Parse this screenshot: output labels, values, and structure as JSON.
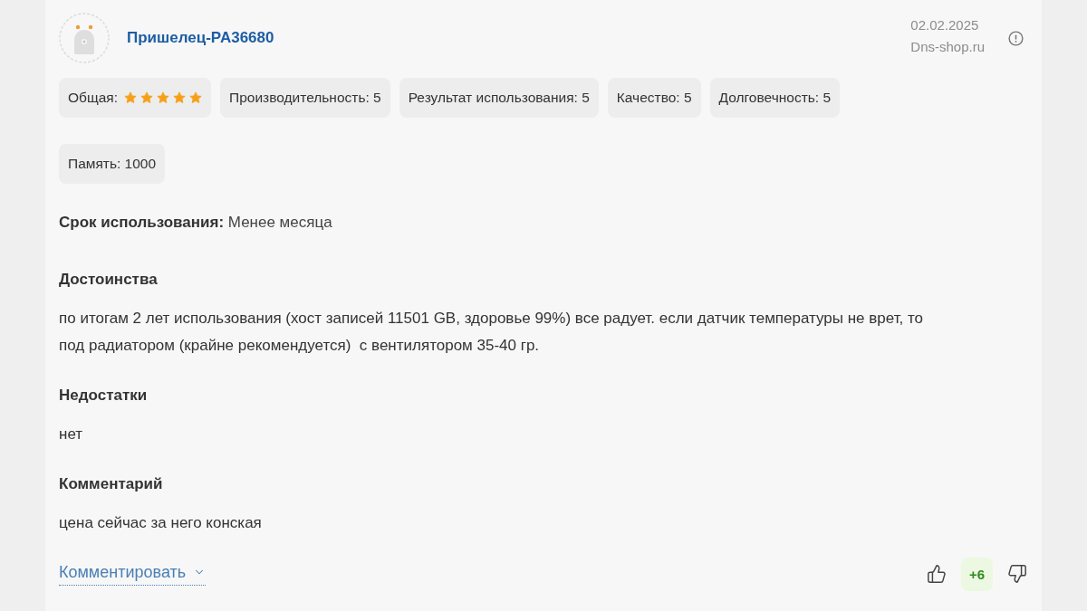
{
  "review": {
    "author": {
      "name": "Пришелец-PA36680"
    },
    "date": "02.02.2025",
    "source": "Dns-shop.ru",
    "ratings": [
      {
        "kind": "stars",
        "label": "Общая:",
        "stars": 5
      },
      {
        "kind": "text",
        "label": "Производительность: 5"
      },
      {
        "kind": "text",
        "label": "Результат использования: 5"
      },
      {
        "kind": "text",
        "label": "Качество: 5"
      },
      {
        "kind": "text",
        "label": "Долговечность: 5"
      }
    ],
    "properties": [
      {
        "label": "Память: 1000"
      }
    ],
    "usage_period": "**Срок использования:** Менее месяца",
    "sections": [
      {
        "heading": "Достоинства",
        "text": "по итогам 2 лет использования (хост записей 11501 GB, здоровье 99%) все радует. если датчик температуры не врет, то под радиатором (крайне рекомендуется)  с вентилятором 35-40 гр."
      },
      {
        "heading": "Недостатки",
        "text": "нет"
      },
      {
        "heading": "Комментарий",
        "text": "цена сейчас за него конская"
      }
    ],
    "comment_link": "Комментировать",
    "votes": {
      "score": "+6"
    }
  }
}
